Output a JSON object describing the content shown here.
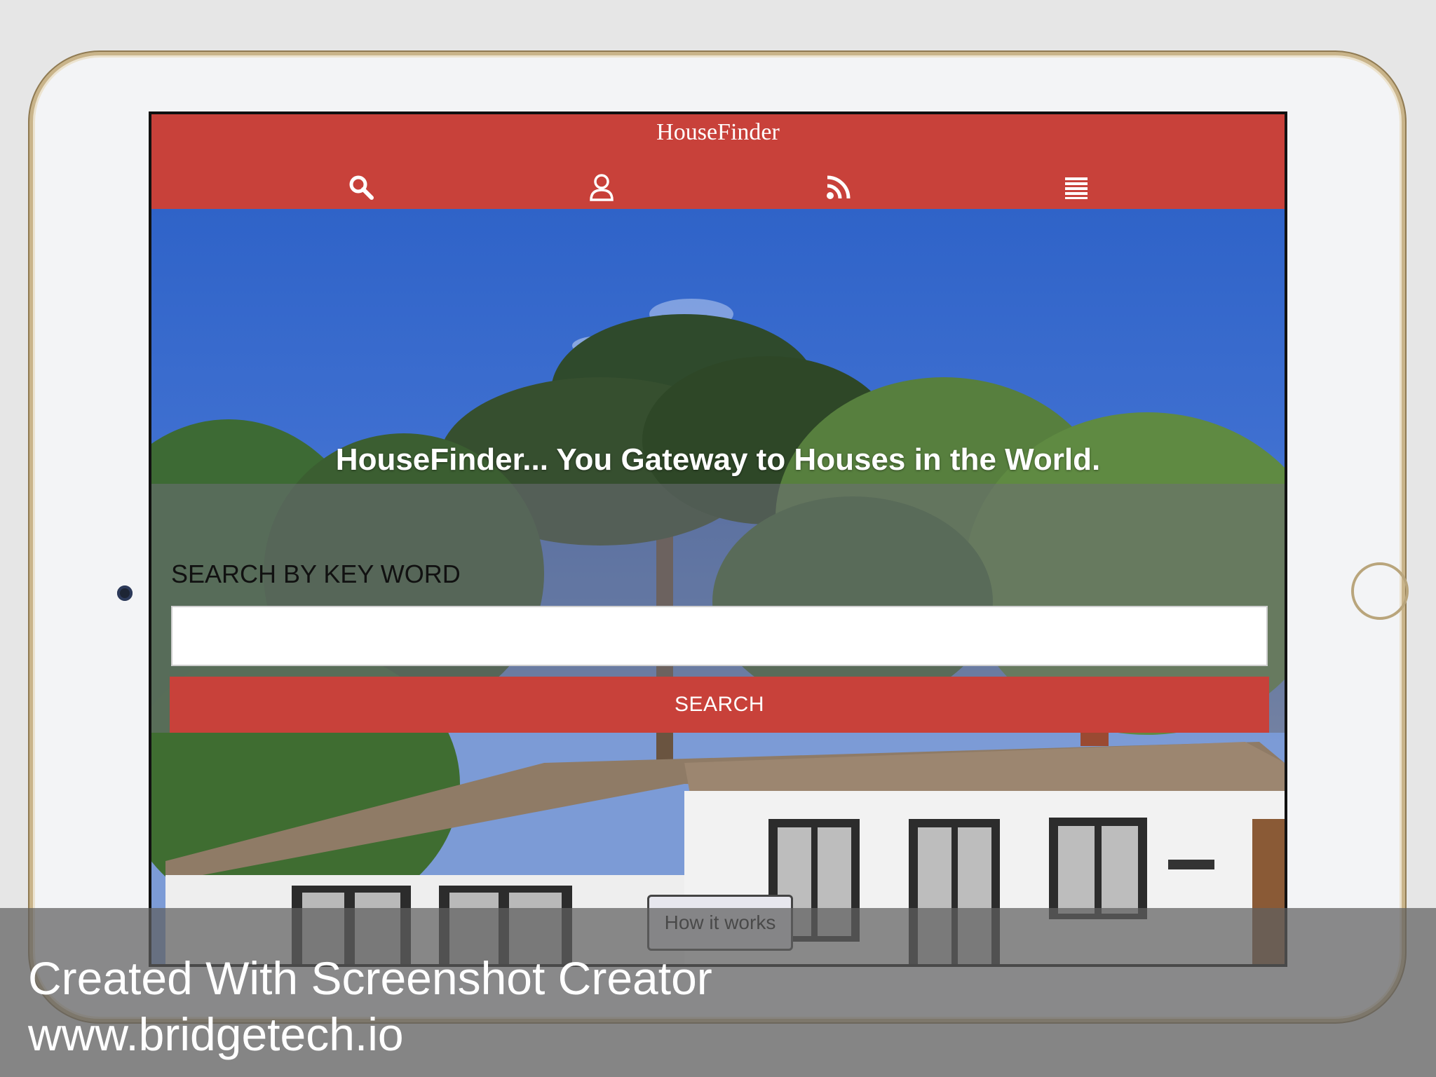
{
  "app": {
    "brand": "HouseFinder"
  },
  "nav": {
    "icons": [
      "search-icon",
      "user-icon",
      "rss-icon",
      "menu-icon"
    ]
  },
  "hero": {
    "headline": "HouseFinder... You Gateway to Houses in the World.",
    "search_label": "SEARCH BY KEY WORD",
    "search_value": "",
    "search_button": "SEARCH",
    "how_button": "How it works"
  },
  "watermark": {
    "line1": "Created With Screenshot Creator",
    "line2": "www.bridgetech.io"
  },
  "colors": {
    "accent": "#c8413a",
    "frame_gold": "#c9b48a",
    "sky": "#3e6fd0"
  }
}
